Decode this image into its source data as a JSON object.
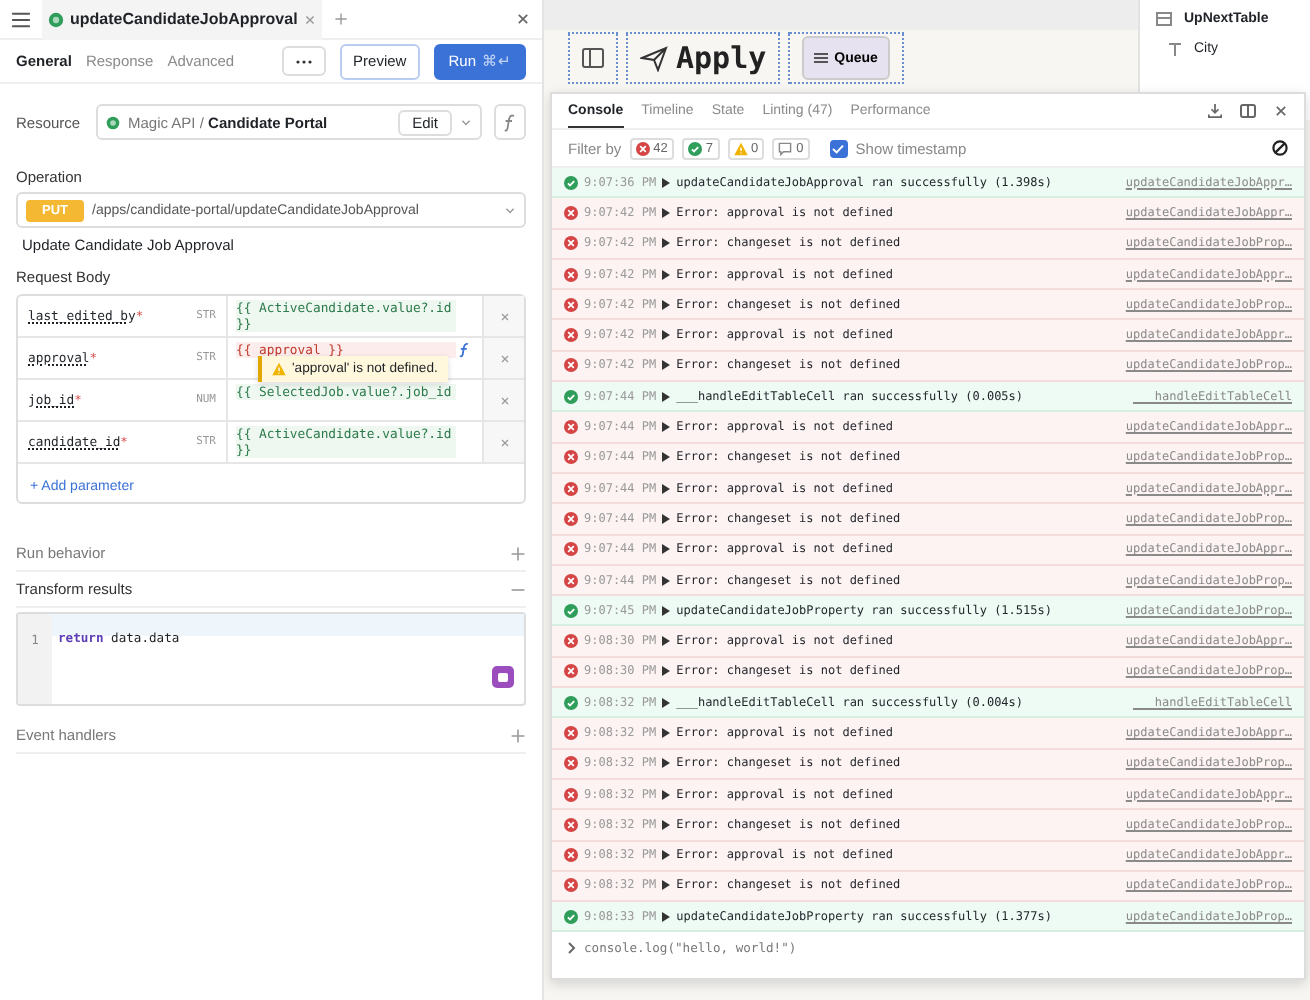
{
  "query_tab": {
    "title": "updateCandidateJobApproval"
  },
  "editor_tabs": [
    {
      "label": "General",
      "selected": true
    },
    {
      "label": "Response",
      "selected": false
    },
    {
      "label": "Advanced",
      "selected": false
    }
  ],
  "actions": {
    "preview": "Preview",
    "run": "Run",
    "run_shortcut": "⌘↵"
  },
  "resource": {
    "label": "Resource",
    "prefix": "Magic API / ",
    "name": "Candidate Portal",
    "edit": "Edit"
  },
  "operation": {
    "label": "Operation",
    "method": "PUT",
    "path": "/apps/candidate-portal/updateCandidateJobApproval",
    "description": "Update Candidate Job Approval"
  },
  "request_body": {
    "label": "Request Body",
    "add": "+ Add parameter",
    "rows": [
      {
        "name": "last_edited_by",
        "marker": "*",
        "type": "STR",
        "value": "{{ ActiveCandidate.value?.id }}",
        "error": false
      },
      {
        "name": "approval",
        "marker": "*",
        "type": "STR",
        "value": "{{ approval }}",
        "error": true,
        "tooltip": "'approval' is not defined."
      },
      {
        "name": "job_id",
        "marker": "*",
        "type": "NUM",
        "value": "{{ SelectedJob.value?.job_id",
        "error": false
      },
      {
        "name": "candidate_id",
        "marker": "*",
        "type": "STR",
        "value": "{{ ActiveCandidate.value?.id }}",
        "error": false
      }
    ]
  },
  "sections": [
    {
      "title": "Run behavior",
      "expanded": false
    },
    {
      "title": "Transform results",
      "expanded": true,
      "line_number": "1",
      "keyword": "return",
      "code": "data.data"
    },
    {
      "title": "Event handlers",
      "expanded": false
    }
  ],
  "canvas": {
    "apply": "Apply",
    "queue": "Queue"
  },
  "inspector": {
    "title": "UpNextTable",
    "items": [
      "City"
    ]
  },
  "console": {
    "tabs": [
      {
        "label": "Console",
        "selected": true
      },
      {
        "label": "Timeline",
        "selected": false
      },
      {
        "label": "State",
        "selected": false
      },
      {
        "label": "Linting (47)",
        "selected": false
      },
      {
        "label": "Performance",
        "selected": false
      }
    ],
    "filter_label": "Filter by",
    "filters": [
      {
        "kind": "error",
        "count": "42"
      },
      {
        "kind": "success",
        "count": "7"
      },
      {
        "kind": "warning",
        "count": "0"
      },
      {
        "kind": "message",
        "count": "0"
      }
    ],
    "show_timestamp": {
      "label": "Show timestamp",
      "checked": true
    },
    "logs": [
      {
        "kind": "success",
        "time": "9:07:36 PM",
        "message": "updateCandidateJobApproval ran successfully (1.398s)",
        "source": "updateCandidateJobAppr…"
      },
      {
        "kind": "error",
        "time": "9:07:42 PM",
        "message": "Error: approval is not defined",
        "source": "updateCandidateJobAppr…"
      },
      {
        "kind": "error",
        "time": "9:07:42 PM",
        "message": "Error: changeset is not defined",
        "source": "updateCandidateJobProp…"
      },
      {
        "kind": "error",
        "time": "9:07:42 PM",
        "message": "Error: approval is not defined",
        "source": "updateCandidateJobAppr…"
      },
      {
        "kind": "error",
        "time": "9:07:42 PM",
        "message": "Error: changeset is not defined",
        "source": "updateCandidateJobProp…"
      },
      {
        "kind": "error",
        "time": "9:07:42 PM",
        "message": "Error: approval is not defined",
        "source": "updateCandidateJobAppr…"
      },
      {
        "kind": "error",
        "time": "9:07:42 PM",
        "message": "Error: changeset is not defined",
        "source": "updateCandidateJobProp…"
      },
      {
        "kind": "success",
        "time": "9:07:44 PM",
        "message": "___handleEditTableCell ran successfully (0.005s)",
        "source": "___handleEditTableCell"
      },
      {
        "kind": "error",
        "time": "9:07:44 PM",
        "message": "Error: approval is not defined",
        "source": "updateCandidateJobAppr…"
      },
      {
        "kind": "error",
        "time": "9:07:44 PM",
        "message": "Error: changeset is not defined",
        "source": "updateCandidateJobProp…"
      },
      {
        "kind": "error",
        "time": "9:07:44 PM",
        "message": "Error: approval is not defined",
        "source": "updateCandidateJobAppr…"
      },
      {
        "kind": "error",
        "time": "9:07:44 PM",
        "message": "Error: changeset is not defined",
        "source": "updateCandidateJobProp…"
      },
      {
        "kind": "error",
        "time": "9:07:44 PM",
        "message": "Error: approval is not defined",
        "source": "updateCandidateJobAppr…"
      },
      {
        "kind": "error",
        "time": "9:07:44 PM",
        "message": "Error: changeset is not defined",
        "source": "updateCandidateJobProp…"
      },
      {
        "kind": "success",
        "time": "9:07:45 PM",
        "message": "updateCandidateJobProperty ran successfully (1.515s)",
        "source": "updateCandidateJobProp…"
      },
      {
        "kind": "error",
        "time": "9:08:30 PM",
        "message": "Error: approval is not defined",
        "source": "updateCandidateJobAppr…"
      },
      {
        "kind": "error",
        "time": "9:08:30 PM",
        "message": "Error: changeset is not defined",
        "source": "updateCandidateJobProp…"
      },
      {
        "kind": "success",
        "time": "9:08:32 PM",
        "message": "___handleEditTableCell ran successfully (0.004s)",
        "source": "___handleEditTableCell"
      },
      {
        "kind": "error",
        "time": "9:08:32 PM",
        "message": "Error: approval is not defined",
        "source": "updateCandidateJobAppr…"
      },
      {
        "kind": "error",
        "time": "9:08:32 PM",
        "message": "Error: changeset is not defined",
        "source": "updateCandidateJobProp…"
      },
      {
        "kind": "error",
        "time": "9:08:32 PM",
        "message": "Error: approval is not defined",
        "source": "updateCandidateJobAppr…"
      },
      {
        "kind": "error",
        "time": "9:08:32 PM",
        "message": "Error: changeset is not defined",
        "source": "updateCandidateJobProp…"
      },
      {
        "kind": "error",
        "time": "9:08:32 PM",
        "message": "Error: approval is not defined",
        "source": "updateCandidateJobAppr…"
      },
      {
        "kind": "error",
        "time": "9:08:32 PM",
        "message": "Error: changeset is not defined",
        "source": "updateCandidateJobProp…"
      },
      {
        "kind": "success",
        "time": "9:08:33 PM",
        "message": "updateCandidateJobProperty ran successfully (1.377s)",
        "source": "updateCandidateJobProp…"
      }
    ],
    "input": "console.log(\"hello, world!\")"
  }
}
